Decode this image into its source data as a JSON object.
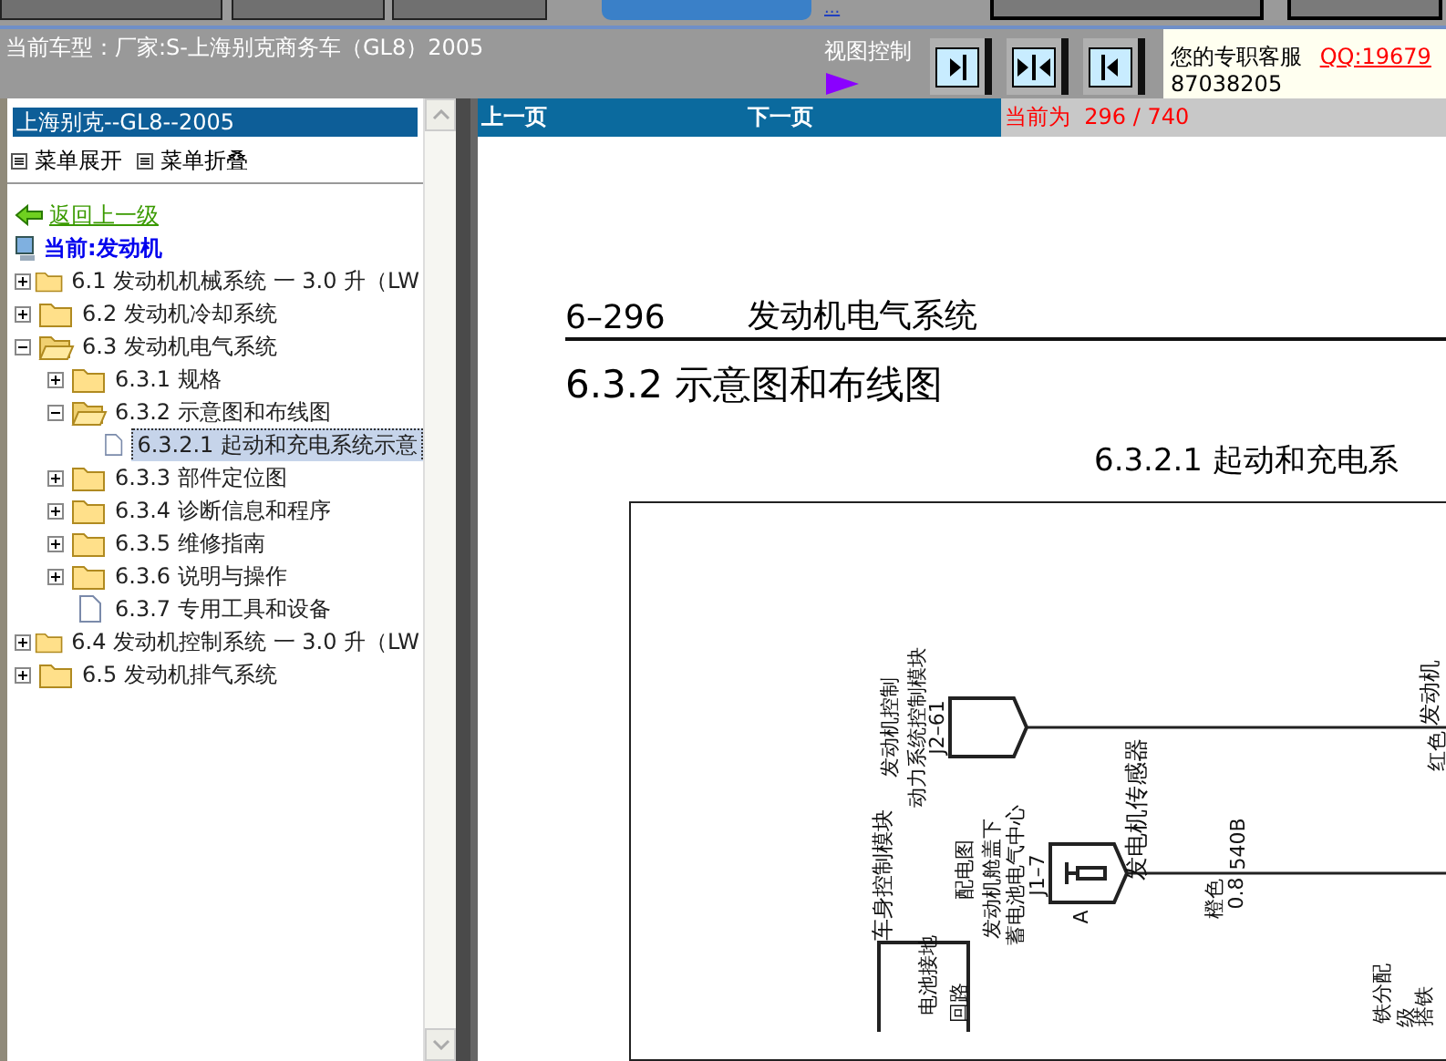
{
  "toolbar": {
    "link": "..."
  },
  "vehicle_info": "当前车型：厂家:S-上海别克商务车（GL8）2005",
  "view_control": {
    "label": "视图控制",
    "buttons": [
      {
        "kind": "right"
      },
      {
        "kind": "both"
      },
      {
        "kind": "left"
      }
    ]
  },
  "support": {
    "label": "您的专职客服",
    "qq": "QQ:19679",
    "phone": "87038205"
  },
  "sidebar": {
    "title": "上海别克--GL8--2005",
    "menu": [
      {
        "label": "菜单展开"
      },
      {
        "label": "菜单折叠"
      }
    ],
    "back_link": "返回上一级",
    "current": "当前:发动机",
    "tree": [
      {
        "label": "6.1 发动机机械系统 一 3.0 升（LW",
        "kind": "folder",
        "expanded": false,
        "selected": false
      },
      {
        "label": "6.2 发动机冷却系统",
        "kind": "folder",
        "expanded": false,
        "selected": false
      },
      {
        "label": "6.3 发动机电气系统",
        "kind": "folder",
        "expanded": true,
        "selected": false,
        "children": [
          {
            "label": "6.3.1 规格",
            "kind": "folder",
            "expanded": false,
            "selected": false
          },
          {
            "label": "6.3.2 示意图和布线图",
            "kind": "folder",
            "expanded": true,
            "selected": false,
            "children": [
              {
                "label": "6.3.2.1 起动和充电系统示意",
                "kind": "page",
                "selected": true
              }
            ]
          },
          {
            "label": "6.3.3 部件定位图",
            "kind": "folder",
            "expanded": false,
            "selected": false
          },
          {
            "label": "6.3.4 诊断信息和程序",
            "kind": "folder",
            "expanded": false,
            "selected": false
          },
          {
            "label": "6.3.5 维修指南",
            "kind": "folder",
            "expanded": false,
            "selected": false
          },
          {
            "label": "6.3.6 说明与操作",
            "kind": "folder",
            "expanded": false,
            "selected": false
          },
          {
            "label": "6.3.7 专用工具和设备",
            "kind": "page",
            "selected": false
          }
        ]
      },
      {
        "label": "6.4 发动机控制系统 一 3.0 升（LW",
        "kind": "folder",
        "expanded": false,
        "selected": false
      },
      {
        "label": "6.5 发动机排气系统",
        "kind": "folder",
        "expanded": false,
        "selected": false
      }
    ]
  },
  "nav": {
    "prev": "上一页",
    "next": "下一页",
    "position": "当前为  296 / 740"
  },
  "document": {
    "page_number": "6–296",
    "section": "发动机电气系统",
    "heading": "6.3.2 示意图和布线图",
    "subheading": "6.3.2.1 起动和充电系",
    "diagram": {
      "labels": [
        "发动机控制",
        "动力系统控制模块",
        "J2–61",
        "车身控制模块",
        "配电图",
        "发动机舱盖下",
        "蓄电池电气中心",
        "J1–7",
        "A",
        "发电机传感器",
        "540B",
        "橙色",
        "0.8",
        "发动机",
        "红色",
        "电池接地",
        "回路",
        "铁分配",
        "级",
        "搭铁"
      ]
    }
  }
}
